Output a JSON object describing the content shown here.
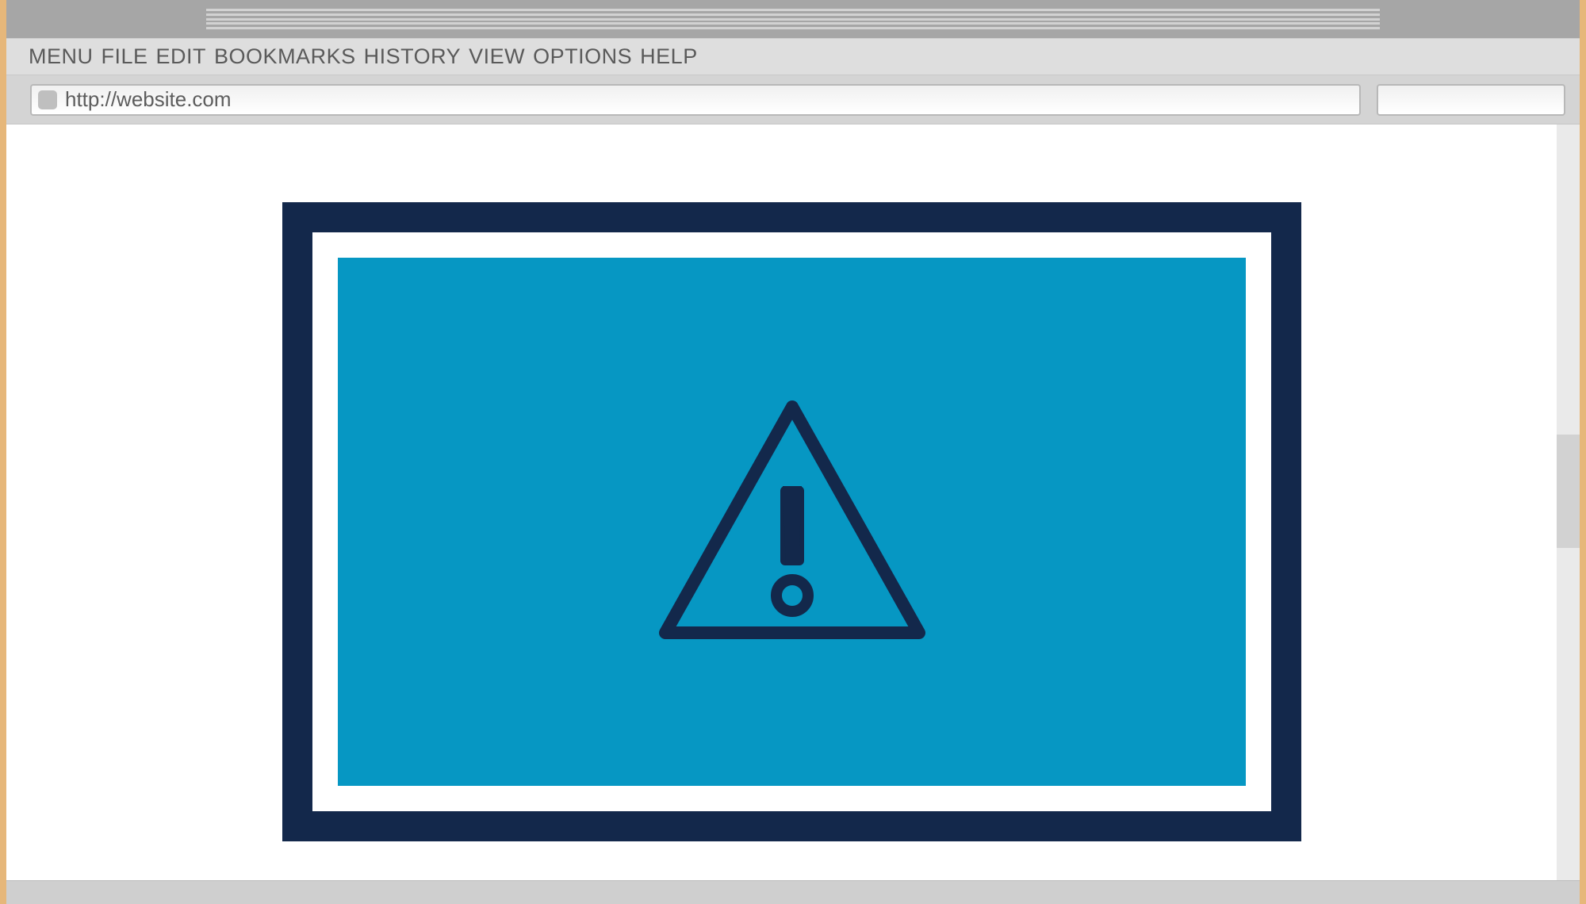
{
  "menu": {
    "items": [
      "MENU",
      "FILE",
      "EDIT",
      "BOOKMARKS",
      "HISTORY",
      "VIEW",
      "OPTIONS",
      "HELP"
    ]
  },
  "address_bar": {
    "url": "http://website.com"
  },
  "search": {
    "value": "",
    "placeholder": ""
  },
  "icons": {
    "search": "search-icon",
    "warning": "warning-triangle-icon",
    "favicon": "page-favicon"
  },
  "colors": {
    "frame_dark": "#13284b",
    "panel_blue": "#0697c3",
    "chrome_gray": "#d4d4d4",
    "page_bg": "#ffffff"
  },
  "scrollbar": {
    "thumb_top_pct": 41,
    "thumb_height_pct": 15
  }
}
